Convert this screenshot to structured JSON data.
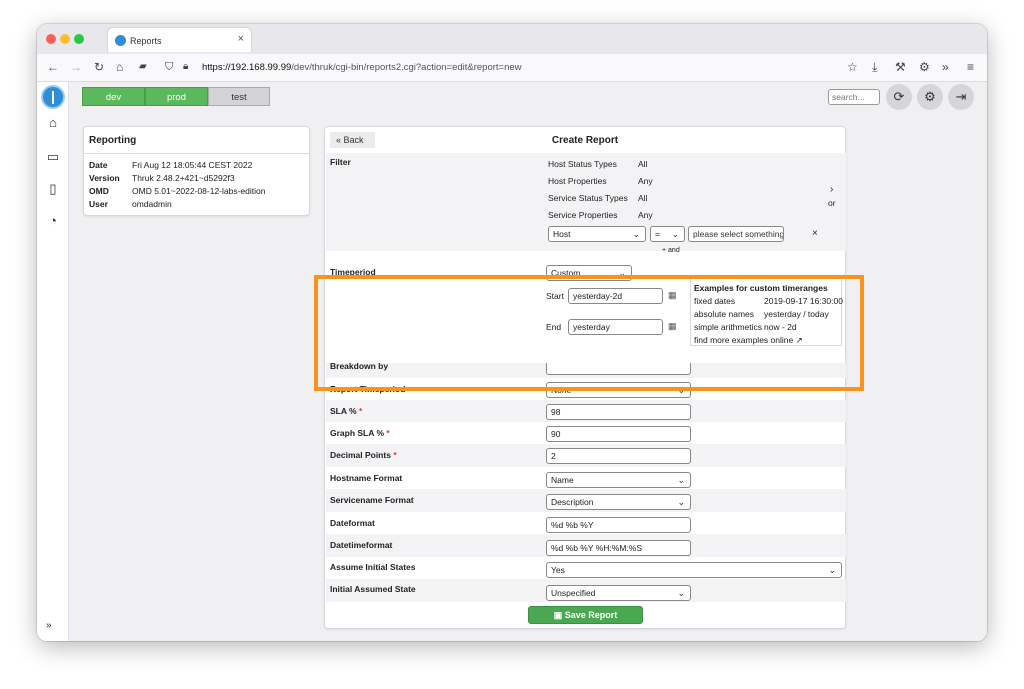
{
  "browser": {
    "tab_title": "Reports",
    "tab_close": "×",
    "url_host": "https://192.168.99.99",
    "url_path": "/dev/thruk/cgi-bin/reports2.cgi?action=edit&report=new"
  },
  "environments": [
    "dev",
    "prod",
    "test"
  ],
  "header": {
    "search_placeholder": "search..."
  },
  "reporting_panel": {
    "title": "Reporting",
    "rows": [
      {
        "key": "Date",
        "value": "Fri Aug 12 18:05:44 CEST 2022"
      },
      {
        "key": "Version",
        "value": "Thruk 2.48.2+421~d5292f3"
      },
      {
        "key": "OMD",
        "value": "OMD 5.01~2022-08-12-labs-edition"
      },
      {
        "key": "User",
        "value": "omdadmin"
      }
    ]
  },
  "report": {
    "back_label": "« Back",
    "title": "Create Report",
    "filter": {
      "label": "Filter",
      "rows": [
        {
          "key": "Host Status Types",
          "value": "All"
        },
        {
          "key": "Host Properties",
          "value": "Any"
        },
        {
          "key": "Service Status Types",
          "value": "All"
        },
        {
          "key": "Service Properties",
          "value": "Any"
        }
      ],
      "field_select": "Host",
      "op_select": "=",
      "value_placeholder": "please select something",
      "remove": "×",
      "or_arrow": "›",
      "or_label": "or",
      "and_label": "+ and"
    },
    "timeperiod": {
      "label": "Timeperiod",
      "select": "Custom",
      "start_label": "Start",
      "start_value": "yesterday-2d",
      "end_label": "End",
      "end_value": "yesterday",
      "examples_title": "Examples for custom timeranges",
      "examples": [
        {
          "key": "fixed dates",
          "value": "2019-09-17 16:30:00"
        },
        {
          "key": "absolute names",
          "value": "yesterday / today"
        },
        {
          "key": "simple arithmetics",
          "value": "now - 2d"
        }
      ],
      "more_link": "find more examples online"
    },
    "fields": [
      {
        "label": "Breakdown by",
        "required": false,
        "value": "",
        "type": "select"
      },
      {
        "label": "Report Timeperiod",
        "required": false,
        "value": "None",
        "type": "select"
      },
      {
        "label": "SLA %",
        "required": true,
        "value": "98",
        "type": "input"
      },
      {
        "label": "Graph SLA %",
        "required": true,
        "value": "90",
        "type": "input"
      },
      {
        "label": "Decimal Points",
        "required": true,
        "value": "2",
        "type": "input"
      },
      {
        "label": "Hostname Format",
        "required": false,
        "value": "Name",
        "type": "select"
      },
      {
        "label": "Servicename Format",
        "required": false,
        "value": "Description",
        "type": "select"
      },
      {
        "label": "Dateformat",
        "required": false,
        "value": "%d %b %Y",
        "type": "input"
      },
      {
        "label": "Datetimeformat",
        "required": false,
        "value": "%d %b %Y  %H:%M:%S",
        "type": "input"
      },
      {
        "label": "Assume Initial States",
        "required": false,
        "value": "Yes",
        "type": "select-wide"
      },
      {
        "label": "Initial Assumed State",
        "required": false,
        "value": "Unspecified",
        "type": "select"
      }
    ],
    "save_label": "Save Report"
  },
  "colors": {
    "env_active": "#5cb85c",
    "env_inactive": "#d4d4d8",
    "highlight": "#f7931e",
    "save": "#4aa853"
  }
}
